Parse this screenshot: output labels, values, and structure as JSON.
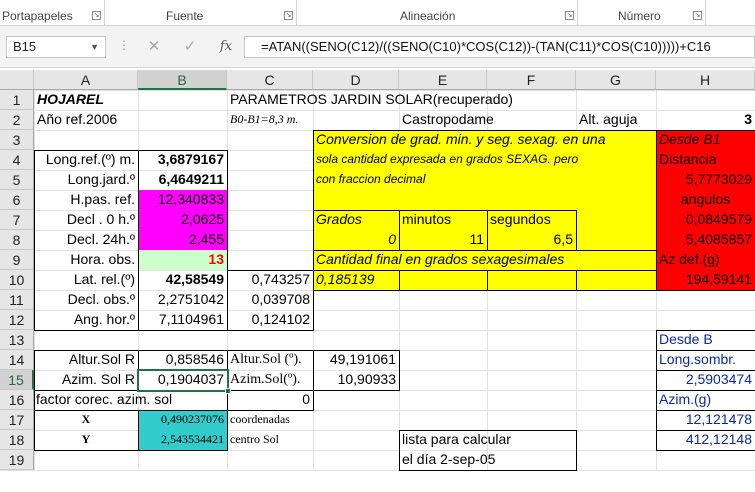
{
  "ribbon": {
    "groups": [
      "Portapapeles",
      "Fuente",
      "Alineación",
      "Número"
    ]
  },
  "formula_bar": {
    "name_box": "B15",
    "cancel": "✕",
    "enter": "✓",
    "fx": "fx",
    "formula": "=ATAN((SENO(C12)/((SENO(C10)*COS(C12))-(TAN(C11)*COS(C10)))))+C16"
  },
  "columns": [
    "A",
    "B",
    "C",
    "D",
    "E",
    "F",
    "G",
    "H"
  ],
  "rows": [
    "1",
    "2",
    "3",
    "4",
    "5",
    "6",
    "7",
    "8",
    "9",
    "10",
    "11",
    "12",
    "13",
    "14",
    "15",
    "16",
    "17",
    "18",
    "19"
  ],
  "cells": {
    "A1": "HOJAREL",
    "C1": "PARAMETROS    JARDIN    SOLAR(recuperado)",
    "A2": "Año ref.2006",
    "C2": "B0-B1=8,3 m.",
    "E2": "Castropodame",
    "G2": "Alt.  aguja",
    "H2": "3",
    "D3": "Conversion de grad. min. y seg. sexag. en  una",
    "H3": "Desde  B1",
    "A4": "Long.ref.(º) m.",
    "B4": "3,6879167",
    "D4": "sola cantidad expresada en grados SEXAG. pero",
    "H4": "Distancia",
    "A5": "Long.jard.º",
    "B5": "6,4649211",
    "D5": "con fraccion decimal",
    "H5": "5,7773029",
    "A6": "H.pas. ref.",
    "B6": "12,340833",
    "H6": "angulos",
    "A7": "Decl . 0 h.º",
    "B7": "2,0625",
    "D7": "Grados",
    "E7": "minutos",
    "F7": "segundos",
    "H7": "0,0849579",
    "A8": "Decl. 24h.º",
    "B8": "2,455",
    "D8": "0",
    "E8": "11",
    "F8": "6,5",
    "H8": "5,4085857",
    "A9": "Hora. obs.",
    "B9": "13",
    "D9": "Cantidad final en grados sexagesimales",
    "H9": "Az def.(g)",
    "A10": "Lat. rel.(º)",
    "B10": "42,58549",
    "C10": "0,743257",
    "D10": "0,185139",
    "H10": "194,59141",
    "A11": "Decl. obs.º",
    "B11": "2,2751042",
    "C11": "0,039708",
    "A12": "Ang. hor.º",
    "B12": "7,1104961",
    "C12": "0,124102",
    "H13": "Desde B",
    "A14": "Altur.Sol R",
    "B14": "0,858546",
    "C14": "Altur.Sol (º).",
    "D14": "49,191061",
    "H14": "Long.sombr.",
    "A15": "Azim. Sol R",
    "B15": "0,1904037",
    "C15": "Azim.Sol(º).",
    "D15": "10,90933",
    "H15": "2,5903474",
    "A16": "factor  corec.  azim. sol",
    "C16": "0",
    "H16": "Azim.(g)",
    "A17": "X",
    "B17": "0,490237076",
    "C17": "coordenadas",
    "H17": "12,121478",
    "A18": "Y",
    "B18": "2,543534421",
    "C18": "centro Sol",
    "E18": "lista para calcular",
    "H18": "412,12148",
    "E19": "el día 2-sep-05"
  },
  "colors": {
    "yellow": "#ffff00",
    "red": "#ff0000",
    "magenta": "#ff00ff",
    "light_green": "#ccffcc",
    "cyan": "#33cccc",
    "header_bg": "#e6e6e6",
    "select_green": "#217346"
  }
}
